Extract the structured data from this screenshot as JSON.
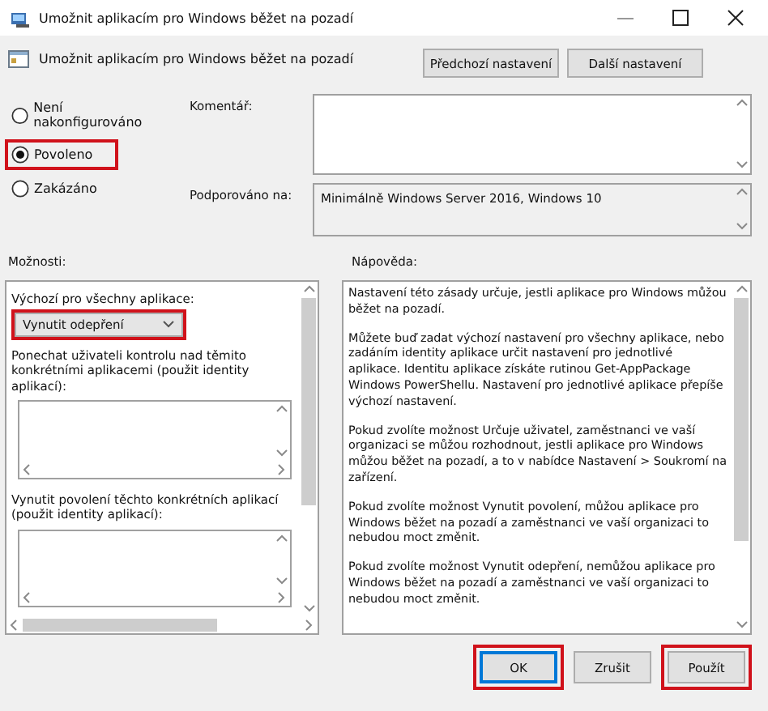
{
  "window": {
    "title": "Umožnit aplikacím pro Windows běžet na pozadí"
  },
  "header": {
    "title": "Umožnit aplikacím pro Windows běžet na pozadí",
    "buttons": [
      {
        "label": "Předchozí nastavení"
      },
      {
        "label": "Další nastavení"
      }
    ]
  },
  "state_options": [
    {
      "label": "Není nakonfigurováno",
      "selected": false,
      "highlighted": false
    },
    {
      "label": "Povoleno",
      "selected": true,
      "highlighted": true
    },
    {
      "label": "Zakázáno",
      "selected": false,
      "highlighted": false
    }
  ],
  "comment": {
    "label": "Komentář:"
  },
  "supported": {
    "label": "Podporováno na:",
    "value": "Minimálně Windows Server 2016, Windows 10"
  },
  "options": {
    "label": "Možnosti:",
    "items": [
      {
        "kind": "dropdown",
        "label": "Výchozí pro všechny aplikace:",
        "value": "Vynutit odepření",
        "highlighted": true
      },
      {
        "kind": "listbox",
        "label": "Ponechat uživateli kontrolu nad těmito konkrétními aplikacemi (použit identity aplikací):"
      },
      {
        "kind": "listbox",
        "label": "Vynutit povolení těchto konkrétních aplikací (použit identity aplikací):"
      }
    ]
  },
  "help": {
    "label": "Nápověda:",
    "paragraphs": [
      "Nastavení této zásady určuje, jestli aplikace pro Windows můžou běžet na pozadí.",
      "Můžete buď zadat výchozí nastavení pro všechny aplikace, nebo zadáním identity aplikace určit nastavení pro jednotlivé aplikace. Identitu aplikace získáte rutinou Get-AppPackage Windows PowerShellu. Nastavení pro jednotlivé aplikace přepíše výchozí nastavení.",
      "Pokud zvolíte možnost Určuje uživatel, zaměstnanci ve vaší organizaci se můžou rozhodnout, jestli aplikace pro Windows můžou běžet na pozadí, a to v nabídce Nastavení > Soukromí na zařízení.",
      "Pokud zvolíte možnost Vynutit povolení, můžou aplikace pro Windows běžet na pozadí a zaměstnanci ve vaší organizaci to nebudou moct změnit.",
      "Pokud zvolíte možnost Vynutit odepření, nemůžou aplikace pro Windows běžet na pozadí a zaměstnanci ve vaší organizaci to nebudou moct změnit."
    ]
  },
  "buttons": [
    {
      "label": "OK",
      "default": true,
      "highlighted": true
    },
    {
      "label": "Zrušit",
      "default": false,
      "highlighted": false
    },
    {
      "label": "Použít",
      "default": false,
      "highlighted": true
    }
  ]
}
